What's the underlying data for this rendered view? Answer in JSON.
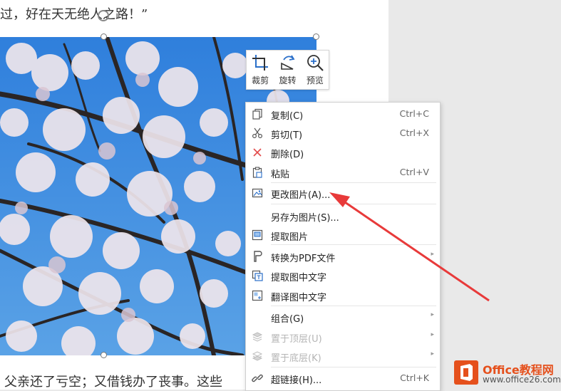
{
  "document": {
    "text_top": "过，好在天无绝人之路！”",
    "text_bottom": "父亲还了亏空；又借钱办了丧事。这些"
  },
  "mini_toolbar": {
    "crop_label": "裁剪",
    "rotate_label": "旋转",
    "preview_label": "预览"
  },
  "context_menu": {
    "items": [
      {
        "label": "复制(C)",
        "shortcut": "Ctrl+C",
        "icon": "copy-icon"
      },
      {
        "label": "剪切(T)",
        "shortcut": "Ctrl+X",
        "icon": "scissors-icon"
      },
      {
        "label": "删除(D)",
        "shortcut": "",
        "icon": "delete-x-icon"
      },
      {
        "label": "粘贴",
        "shortcut": "Ctrl+V",
        "icon": "clipboard-icon"
      },
      {
        "label": "更改图片(A)...",
        "shortcut": "",
        "icon": "change-picture-icon"
      },
      {
        "label": "另存为图片(S)...",
        "shortcut": "",
        "icon": ""
      },
      {
        "label": "提取图片",
        "shortcut": "",
        "icon": "extract-picture-icon"
      },
      {
        "label": "转换为PDF文件",
        "shortcut": "",
        "icon": "pdf-icon"
      },
      {
        "label": "提取图中文字",
        "shortcut": "",
        "icon": "extract-text-icon"
      },
      {
        "label": "翻译图中文字",
        "shortcut": "",
        "icon": "translate-text-icon"
      },
      {
        "label": "组合(G)",
        "shortcut": "",
        "icon": ""
      },
      {
        "label": "置于顶层(U)",
        "shortcut": "",
        "icon": "layer-top-icon"
      },
      {
        "label": "置于底层(K)",
        "shortcut": "",
        "icon": "layer-bottom-icon"
      },
      {
        "label": "超链接(H)...",
        "shortcut": "Ctrl+K",
        "icon": "link-icon"
      }
    ]
  },
  "watermark": {
    "name": "Office教程网",
    "url": "www.office26.com"
  },
  "colors": {
    "arrow": "#e83a3a",
    "delete_icon": "#e34b4b",
    "brand": "#e5501c",
    "sky": "#3f8ee0"
  }
}
